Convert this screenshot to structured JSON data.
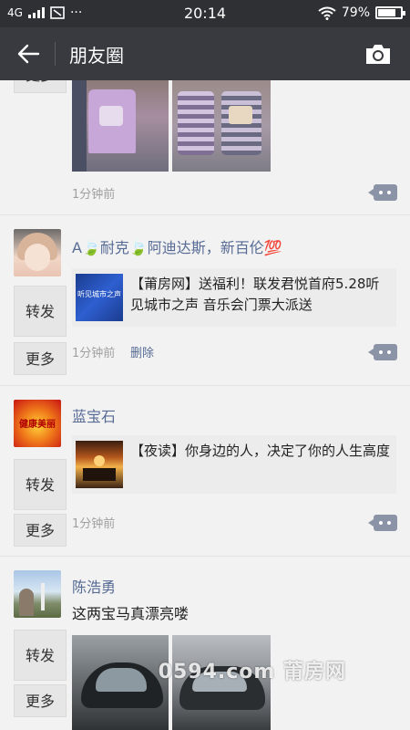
{
  "status_bar": {
    "network": "4G",
    "time": "20:14",
    "dots": "···",
    "battery": "79%",
    "battery_level": 0.79
  },
  "header": {
    "title": "朋友圈"
  },
  "posts": [
    {
      "time": "1分钟前",
      "more_label": "更多"
    },
    {
      "name": "A🍃耐克🍃阿迪达斯，新百伦💯",
      "link_title": "【莆房网】送福利！联发君悦首府5.28听见城市之声 音乐会门票大派送",
      "time": "1分钟前",
      "delete": "删除",
      "forward_label": "转发",
      "more_label": "更多"
    },
    {
      "name": "蓝宝石",
      "avatar_text": "健康美丽",
      "link_title": "【夜读】你身边的人，决定了你的人生高度",
      "time": "1分钟前",
      "forward_label": "转发",
      "more_label": "更多"
    },
    {
      "name": "陈浩勇",
      "text": "这两宝马真漂亮喽",
      "forward_label": "转发",
      "more_label": "更多"
    }
  ],
  "link_thumb_text": "听见城市之声",
  "watermark": "0594.com 莆房网",
  "colors": {
    "header_bg": "#393a3f",
    "status_bg": "#2f3033",
    "name_link": "#576b95",
    "feed_bg": "#f2f2f2"
  }
}
